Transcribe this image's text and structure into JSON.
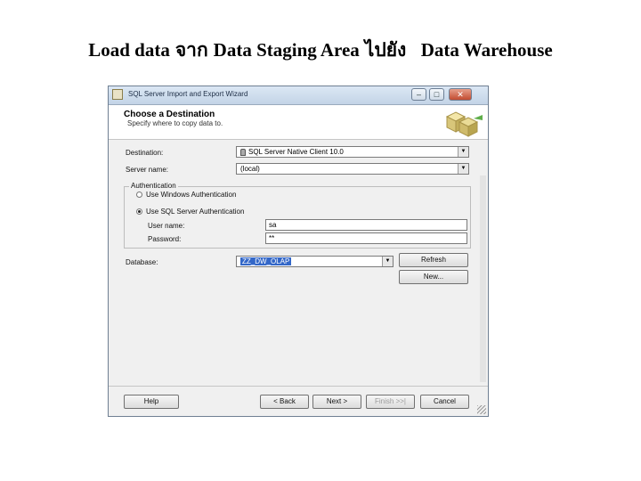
{
  "slide": {
    "title_part1": "Load data",
    "title_part2": "จาก",
    "title_part3": "Data Staging Area",
    "title_part4": "ไปยัง",
    "title_part5": "Data Warehouse"
  },
  "window": {
    "title": "SQL Server Import and Export Wizard",
    "minimize": "–",
    "maximize": "□",
    "close": "✕"
  },
  "header": {
    "title": "Choose a Destination",
    "subtitle": "Specify where to copy data to."
  },
  "form": {
    "destination_label": "Destination:",
    "destination_value": "SQL Server Native Client 10.0",
    "server_label": "Server name:",
    "server_value": "(local)",
    "auth_legend": "Authentication",
    "windows_auth_label": "Use Windows Authentication",
    "sql_auth_label": "Use SQL Server Authentication",
    "username_label": "User name:",
    "username_value": "sa",
    "password_label": "Password:",
    "password_value": "**",
    "database_label": "Database:",
    "database_value": "ZZ_DW_OLAP",
    "refresh_label": "Refresh",
    "new_label": "New..."
  },
  "footer": {
    "help_label": "Help",
    "back_label": "< Back",
    "next_label": "Next >",
    "finish_label": "Finish >>|",
    "cancel_label": "Cancel"
  }
}
